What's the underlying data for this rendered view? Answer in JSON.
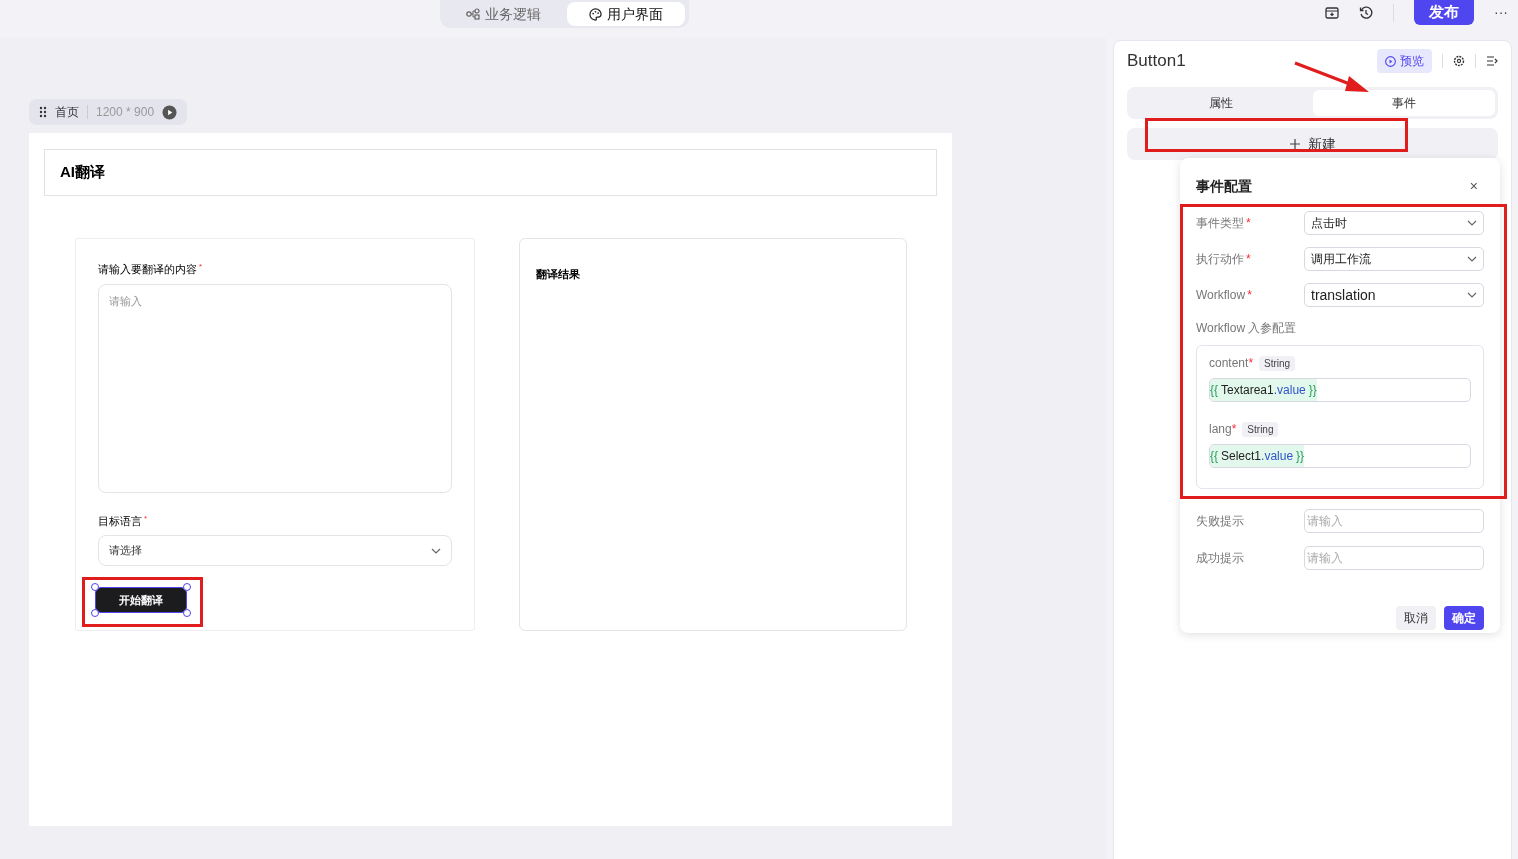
{
  "top_tabs": [
    {
      "label": "业务逻辑",
      "selected": false,
      "kind": "flow"
    },
    {
      "label": "用户界面",
      "selected": true,
      "kind": "palette"
    }
  ],
  "toolbar": {
    "publish": "发布",
    "more": "···"
  },
  "page_bar": {
    "name": "首页",
    "size": "1200 * 900"
  },
  "app": {
    "title": "AI翻译",
    "input_label": "请输入要翻译的内容",
    "input_mark": "*",
    "input_placeholder": "请输入",
    "lang_label": "目标语言",
    "lang_mark": "*",
    "lang_placeholder": "请选择",
    "button": "开始翻译",
    "result_title": "翻译结果"
  },
  "panel": {
    "title": "Button1",
    "preview": "预览",
    "tabs": [
      {
        "label": "属性",
        "selected": false
      },
      {
        "label": "事件",
        "selected": true
      }
    ],
    "new_button": "新建"
  },
  "event_config": {
    "title": "事件配置",
    "close": "×",
    "fields": [
      {
        "label": "事件类型",
        "mark": "*",
        "value": "点击时"
      },
      {
        "label": "执行动作",
        "mark": "*",
        "value": "调用工作流"
      },
      {
        "label": "Workflow",
        "mark": "*",
        "value": "translation"
      }
    ],
    "params_title": "Workflow 入参配置",
    "params": [
      {
        "name": "content",
        "mark": "*",
        "type": "String",
        "open": "{{",
        "object": "Textarea1",
        "property": ".value",
        "close": "}}"
      },
      {
        "name": "lang",
        "mark": "*",
        "type": "String",
        "open": "{{",
        "object": "Select1",
        "property": ".value",
        "close": "}}"
      }
    ],
    "hints": [
      {
        "label": "失败提示",
        "placeholder": "请输入"
      },
      {
        "label": "成功提示",
        "placeholder": "请输入"
      }
    ],
    "cancel": "取消",
    "ok": "确定"
  }
}
